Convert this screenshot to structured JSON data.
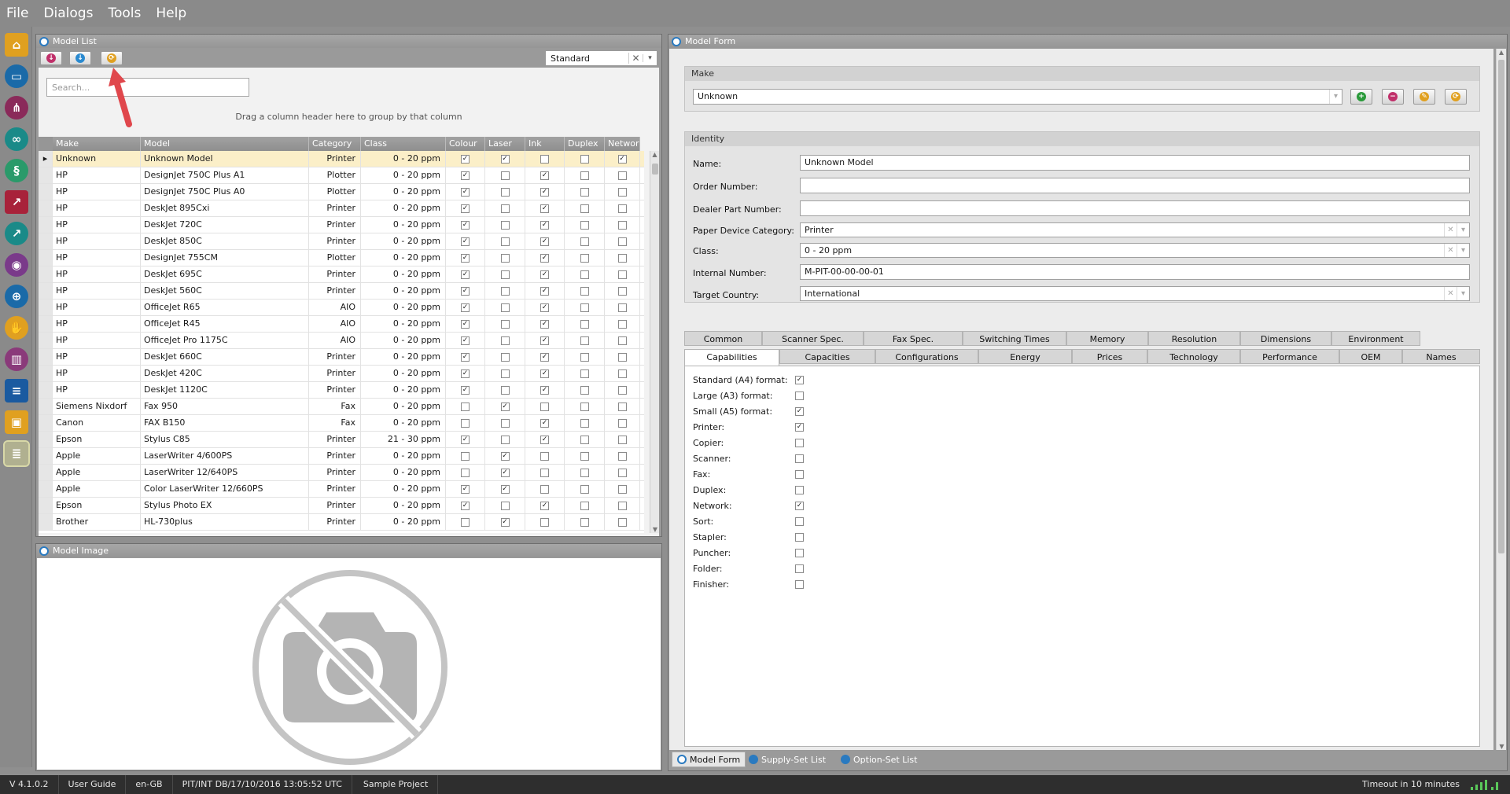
{
  "menu": [
    "File",
    "Dialogs",
    "Tools",
    "Help"
  ],
  "model_list": {
    "title": "Model List",
    "view_select": "Standard",
    "search_placeholder": "Search...",
    "group_hint": "Drag a column header here to group by that column",
    "columns": [
      "Make",
      "Model",
      "Category",
      "Class",
      "Colour",
      "Laser",
      "Ink",
      "Duplex",
      "Networ"
    ],
    "rows": [
      {
        "make": "Unknown",
        "model": "Unknown Model",
        "category": "Printer",
        "class": "0  - 20 ppm",
        "colour": true,
        "laser": true,
        "ink": false,
        "duplex": false,
        "network": true
      },
      {
        "make": "HP",
        "model": "DesignJet 750C Plus A1",
        "category": "Plotter",
        "class": "0  - 20 ppm",
        "colour": true,
        "laser": false,
        "ink": true,
        "duplex": false,
        "network": false
      },
      {
        "make": "HP",
        "model": "DesignJet 750C Plus A0",
        "category": "Plotter",
        "class": "0  - 20 ppm",
        "colour": true,
        "laser": false,
        "ink": true,
        "duplex": false,
        "network": false
      },
      {
        "make": "HP",
        "model": "DeskJet 895Cxi",
        "category": "Printer",
        "class": "0  - 20 ppm",
        "colour": true,
        "laser": false,
        "ink": true,
        "duplex": false,
        "network": false
      },
      {
        "make": "HP",
        "model": "DeskJet 720C",
        "category": "Printer",
        "class": "0  - 20 ppm",
        "colour": true,
        "laser": false,
        "ink": true,
        "duplex": false,
        "network": false
      },
      {
        "make": "HP",
        "model": "DeskJet 850C",
        "category": "Printer",
        "class": "0  - 20 ppm",
        "colour": true,
        "laser": false,
        "ink": true,
        "duplex": false,
        "network": false
      },
      {
        "make": "HP",
        "model": "DesignJet 755CM",
        "category": "Plotter",
        "class": "0  - 20 ppm",
        "colour": true,
        "laser": false,
        "ink": true,
        "duplex": false,
        "network": false
      },
      {
        "make": "HP",
        "model": "DeskJet 695C",
        "category": "Printer",
        "class": "0  - 20 ppm",
        "colour": true,
        "laser": false,
        "ink": true,
        "duplex": false,
        "network": false
      },
      {
        "make": "HP",
        "model": "DeskJet 560C",
        "category": "Printer",
        "class": "0  - 20 ppm",
        "colour": true,
        "laser": false,
        "ink": true,
        "duplex": false,
        "network": false
      },
      {
        "make": "HP",
        "model": "OfficeJet R65",
        "category": "AIO",
        "class": "0  - 20 ppm",
        "colour": true,
        "laser": false,
        "ink": true,
        "duplex": false,
        "network": false
      },
      {
        "make": "HP",
        "model": "OfficeJet R45",
        "category": "AIO",
        "class": "0  - 20 ppm",
        "colour": true,
        "laser": false,
        "ink": true,
        "duplex": false,
        "network": false
      },
      {
        "make": "HP",
        "model": "OfficeJet Pro 1175C",
        "category": "AIO",
        "class": "0  - 20 ppm",
        "colour": true,
        "laser": false,
        "ink": true,
        "duplex": false,
        "network": false
      },
      {
        "make": "HP",
        "model": "DeskJet 660C",
        "category": "Printer",
        "class": "0  - 20 ppm",
        "colour": true,
        "laser": false,
        "ink": true,
        "duplex": false,
        "network": false
      },
      {
        "make": "HP",
        "model": "DeskJet 420C",
        "category": "Printer",
        "class": "0  - 20 ppm",
        "colour": true,
        "laser": false,
        "ink": true,
        "duplex": false,
        "network": false
      },
      {
        "make": "HP",
        "model": "DeskJet 1120C",
        "category": "Printer",
        "class": "0  - 20 ppm",
        "colour": true,
        "laser": false,
        "ink": true,
        "duplex": false,
        "network": false
      },
      {
        "make": "Siemens Nixdorf",
        "model": "Fax 950",
        "category": "Fax",
        "class": "0  - 20 ppm",
        "colour": false,
        "laser": true,
        "ink": false,
        "duplex": false,
        "network": false
      },
      {
        "make": "Canon",
        "model": "FAX B150",
        "category": "Fax",
        "class": "0  - 20 ppm",
        "colour": false,
        "laser": false,
        "ink": true,
        "duplex": false,
        "network": false
      },
      {
        "make": "Epson",
        "model": "Stylus C85",
        "category": "Printer",
        "class": "21 - 30 ppm",
        "colour": true,
        "laser": false,
        "ink": true,
        "duplex": false,
        "network": false
      },
      {
        "make": "Apple",
        "model": "LaserWriter 4/600PS",
        "category": "Printer",
        "class": "0  - 20 ppm",
        "colour": false,
        "laser": true,
        "ink": false,
        "duplex": false,
        "network": false
      },
      {
        "make": "Apple",
        "model": "LaserWriter 12/640PS",
        "category": "Printer",
        "class": "0  - 20 ppm",
        "colour": false,
        "laser": true,
        "ink": false,
        "duplex": false,
        "network": false
      },
      {
        "make": "Apple",
        "model": "Color LaserWriter 12/660PS",
        "category": "Printer",
        "class": "0  - 20 ppm",
        "colour": true,
        "laser": true,
        "ink": false,
        "duplex": false,
        "network": false
      },
      {
        "make": "Epson",
        "model": "Stylus Photo EX",
        "category": "Printer",
        "class": "0  - 20 ppm",
        "colour": true,
        "laser": false,
        "ink": true,
        "duplex": false,
        "network": false
      },
      {
        "make": "Brother",
        "model": "HL-730plus",
        "category": "Printer",
        "class": "0  - 20 ppm",
        "colour": false,
        "laser": true,
        "ink": false,
        "duplex": false,
        "network": false
      }
    ]
  },
  "model_image": {
    "title": "Model Image"
  },
  "model_form": {
    "title": "Model Form",
    "make": {
      "title": "Make",
      "value": "Unknown"
    },
    "identity": {
      "title": "Identity",
      "name_label": "Name:",
      "name_value": "Unknown Model",
      "order_label": "Order Number:",
      "order_value": "",
      "dealer_label": "Dealer Part Number:",
      "dealer_value": "",
      "category_label": "Paper Device Category:",
      "category_value": "Printer",
      "class_label": "Class:",
      "class_value": "0  - 20 ppm",
      "internal_label": "Internal Number:",
      "internal_value": "M-PIT-00-00-00-01",
      "country_label": "Target Country:",
      "country_value": "International"
    },
    "tabs_row1": [
      "Common",
      "Scanner Spec.",
      "Fax Spec.",
      "Switching Times",
      "Memory",
      "Resolution",
      "Dimensions",
      "Environment"
    ],
    "tabs_row2": [
      "Capabilities",
      "Capacities",
      "Configurations",
      "Energy",
      "Prices",
      "Technology",
      "Performance",
      "OEM",
      "Names"
    ],
    "capabilities": [
      {
        "label": "Standard (A4) format:",
        "checked": true
      },
      {
        "label": "Large (A3) format:",
        "checked": false
      },
      {
        "label": "Small (A5) format:",
        "checked": true
      },
      {
        "label": "Printer:",
        "checked": true
      },
      {
        "label": "Copier:",
        "checked": false
      },
      {
        "label": "Scanner:",
        "checked": false
      },
      {
        "label": "Fax:",
        "checked": false
      },
      {
        "label": "Duplex:",
        "checked": false
      },
      {
        "label": "Network:",
        "checked": true
      },
      {
        "label": "Sort:",
        "checked": false
      },
      {
        "label": "Stapler:",
        "checked": false
      },
      {
        "label": "Puncher:",
        "checked": false
      },
      {
        "label": "Folder:",
        "checked": false
      },
      {
        "label": "Finisher:",
        "checked": false
      }
    ],
    "bottom_tabs": [
      "Model Form",
      "Supply-Set List",
      "Option-Set List"
    ]
  },
  "statusbar": {
    "version": "V 4.1.0.2",
    "user_guide": "User Guide",
    "locale": "en-GB",
    "db": "PIT/INT DB/17/10/2016 13:05:52 UTC",
    "project": "Sample Project",
    "timeout": "Timeout in 10 minutes"
  },
  "colors": {
    "accent": "#2a7ac0",
    "selected_row": "#fbefc8",
    "annotation_arrow": "#e0474c"
  }
}
